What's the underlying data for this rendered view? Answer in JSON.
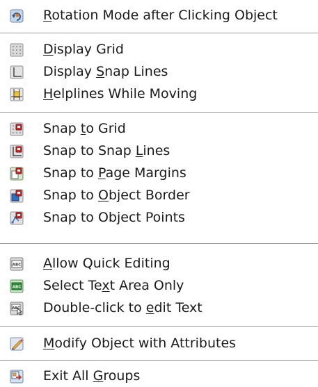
{
  "menu": {
    "items": [
      {
        "icon": "rotation-icon",
        "pre": "",
        "mn": "R",
        "post": "otation Mode after Clicking Object"
      },
      {
        "icon": "grid-icon",
        "pre": "",
        "mn": "D",
        "post": "isplay Grid"
      },
      {
        "icon": "snap-lines-icon",
        "pre": "Display ",
        "mn": "S",
        "post": "nap Lines"
      },
      {
        "icon": "helplines-icon",
        "pre": "",
        "mn": "H",
        "post": "elplines While Moving"
      },
      {
        "icon": "snap-to-grid-icon",
        "pre": "Snap ",
        "mn": "t",
        "post": "o Grid"
      },
      {
        "icon": "snap-to-snap-lines-icon",
        "pre": "Snap to Snap ",
        "mn": "L",
        "post": "ines"
      },
      {
        "icon": "snap-to-page-margins-icon",
        "pre": "Snap to ",
        "mn": "P",
        "post": "age Margins"
      },
      {
        "icon": "snap-to-object-border-icon",
        "pre": "Snap to ",
        "mn": "O",
        "post": "bject Border"
      },
      {
        "icon": "snap-to-object-points-icon",
        "pre": "Snap to Object Points",
        "mn": "",
        "post": ""
      },
      {
        "icon": "allow-quick-editing-icon",
        "pre": "",
        "mn": "A",
        "post": "llow Quick Editing"
      },
      {
        "icon": "select-text-area-icon",
        "pre": "Select Te",
        "mn": "x",
        "post": "t Area Only"
      },
      {
        "icon": "double-click-edit-text-icon",
        "pre": "Double-click to ",
        "mn": "e",
        "post": "dit Text"
      },
      {
        "icon": "modify-object-attributes-icon",
        "pre": "",
        "mn": "M",
        "post": "odify Object with Attributes"
      },
      {
        "icon": "exit-all-groups-icon",
        "pre": "Exit All ",
        "mn": "G",
        "post": "roups"
      }
    ]
  }
}
